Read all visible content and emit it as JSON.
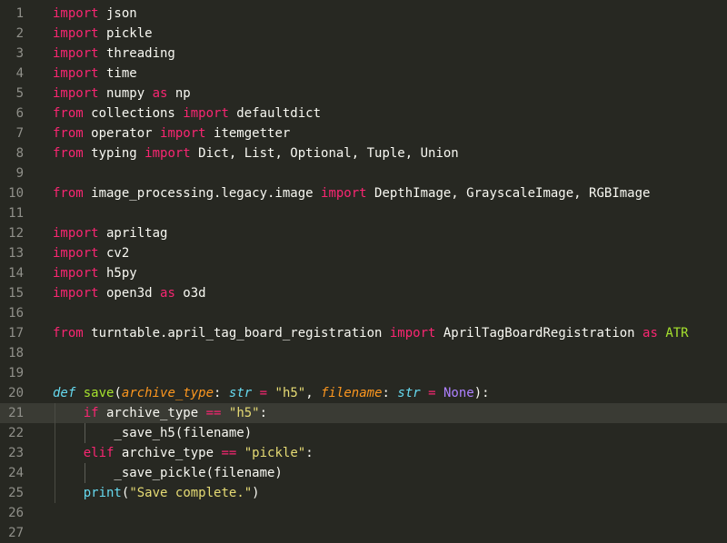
{
  "editor": {
    "language": "python",
    "theme_colors": {
      "background": "#272822",
      "keyword": "#f92672",
      "function": "#a6e22e",
      "string": "#e6db74",
      "constant": "#ae81ff",
      "param": "#fd971f",
      "type": "#66d9ef",
      "text": "#f8f8f2",
      "line_number": "#90908a"
    },
    "active_line": 21,
    "lines": [
      {
        "n": "1",
        "tokens": [
          [
            "kw",
            "import"
          ],
          [
            "pl",
            " json"
          ]
        ]
      },
      {
        "n": "2",
        "tokens": [
          [
            "kw",
            "import"
          ],
          [
            "pl",
            " pickle"
          ]
        ]
      },
      {
        "n": "3",
        "tokens": [
          [
            "kw",
            "import"
          ],
          [
            "pl",
            " threading"
          ]
        ]
      },
      {
        "n": "4",
        "tokens": [
          [
            "kw",
            "import"
          ],
          [
            "pl",
            " time"
          ]
        ]
      },
      {
        "n": "5",
        "tokens": [
          [
            "kw",
            "import"
          ],
          [
            "pl",
            " numpy "
          ],
          [
            "kw",
            "as"
          ],
          [
            "pl",
            " np"
          ]
        ]
      },
      {
        "n": "6",
        "tokens": [
          [
            "kw",
            "from"
          ],
          [
            "pl",
            " collections "
          ],
          [
            "kw",
            "import"
          ],
          [
            "pl",
            " defaultdict"
          ]
        ]
      },
      {
        "n": "7",
        "tokens": [
          [
            "kw",
            "from"
          ],
          [
            "pl",
            " operator "
          ],
          [
            "kw",
            "import"
          ],
          [
            "pl",
            " itemgetter"
          ]
        ]
      },
      {
        "n": "8",
        "tokens": [
          [
            "kw",
            "from"
          ],
          [
            "pl",
            " typing "
          ],
          [
            "kw",
            "import"
          ],
          [
            "pl",
            " Dict, List, Optional, Tuple, Union"
          ]
        ]
      },
      {
        "n": "9",
        "tokens": []
      },
      {
        "n": "10",
        "tokens": [
          [
            "kw",
            "from"
          ],
          [
            "pl",
            " image_processing.legacy.image "
          ],
          [
            "kw",
            "import"
          ],
          [
            "pl",
            " DepthImage, GrayscaleImage, RGBImage"
          ]
        ]
      },
      {
        "n": "11",
        "tokens": []
      },
      {
        "n": "12",
        "tokens": [
          [
            "kw",
            "import"
          ],
          [
            "pl",
            " apriltag"
          ]
        ]
      },
      {
        "n": "13",
        "tokens": [
          [
            "kw",
            "import"
          ],
          [
            "pl",
            " cv2"
          ]
        ]
      },
      {
        "n": "14",
        "tokens": [
          [
            "kw",
            "import"
          ],
          [
            "pl",
            " h5py"
          ]
        ]
      },
      {
        "n": "15",
        "tokens": [
          [
            "kw",
            "import"
          ],
          [
            "pl",
            " open3d "
          ],
          [
            "kw",
            "as"
          ],
          [
            "pl",
            " o3d"
          ]
        ]
      },
      {
        "n": "16",
        "tokens": []
      },
      {
        "n": "17",
        "tokens": [
          [
            "kw",
            "from"
          ],
          [
            "pl",
            " turntable.april_tag_board_registration "
          ],
          [
            "kw",
            "import"
          ],
          [
            "pl",
            " AprilTagBoardRegistration "
          ],
          [
            "kw",
            "as"
          ],
          [
            "pl",
            " "
          ],
          [
            "fn",
            "ATR"
          ]
        ]
      },
      {
        "n": "18",
        "tokens": []
      },
      {
        "n": "19",
        "tokens": []
      },
      {
        "n": "20",
        "tokens": [
          [
            "def",
            "def"
          ],
          [
            "pl",
            " "
          ],
          [
            "fn",
            "save"
          ],
          [
            "pl",
            "("
          ],
          [
            "param",
            "archive_type"
          ],
          [
            "pl",
            ": "
          ],
          [
            "type",
            "str"
          ],
          [
            "pl",
            " "
          ],
          [
            "op",
            "="
          ],
          [
            "pl",
            " "
          ],
          [
            "str",
            "\"h5\""
          ],
          [
            "pl",
            ", "
          ],
          [
            "param",
            "filename"
          ],
          [
            "pl",
            ": "
          ],
          [
            "type",
            "str"
          ],
          [
            "pl",
            " "
          ],
          [
            "op",
            "="
          ],
          [
            "pl",
            " "
          ],
          [
            "const",
            "None"
          ],
          [
            "pl",
            "):"
          ]
        ]
      },
      {
        "n": "21",
        "tokens": [
          [
            "pl",
            "    "
          ],
          [
            "kw",
            "if"
          ],
          [
            "pl",
            " archive_type "
          ],
          [
            "op",
            "=="
          ],
          [
            "pl",
            " "
          ],
          [
            "str",
            "\"h5\""
          ],
          [
            "pl",
            ":"
          ]
        ]
      },
      {
        "n": "22",
        "tokens": [
          [
            "pl",
            "        _save_h5(filename)"
          ]
        ]
      },
      {
        "n": "23",
        "tokens": [
          [
            "pl",
            "    "
          ],
          [
            "kw",
            "elif"
          ],
          [
            "pl",
            " archive_type "
          ],
          [
            "op",
            "=="
          ],
          [
            "pl",
            " "
          ],
          [
            "str",
            "\"pickle\""
          ],
          [
            "pl",
            ":"
          ]
        ]
      },
      {
        "n": "24",
        "tokens": [
          [
            "pl",
            "        _save_pickle(filename)"
          ]
        ]
      },
      {
        "n": "25",
        "tokens": [
          [
            "pl",
            "    "
          ],
          [
            "builtin",
            "print"
          ],
          [
            "pl",
            "("
          ],
          [
            "str",
            "\"Save complete.\""
          ],
          [
            "pl",
            ")"
          ]
        ]
      },
      {
        "n": "26",
        "tokens": []
      },
      {
        "n": "27",
        "tokens": []
      }
    ]
  }
}
